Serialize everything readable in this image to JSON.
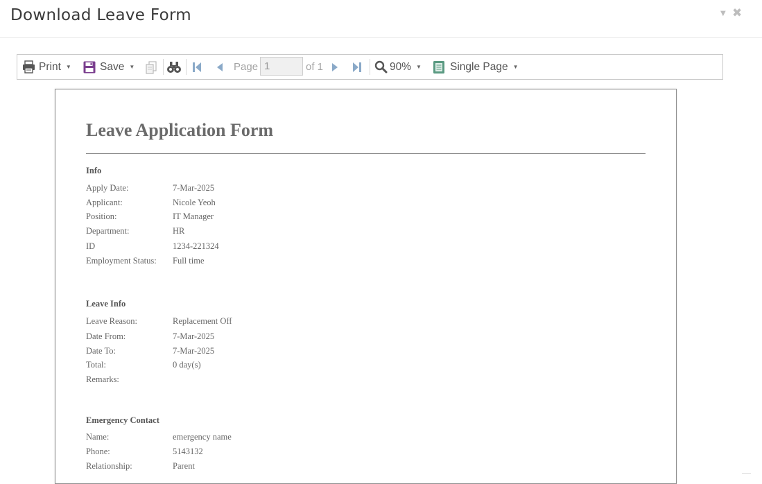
{
  "modal": {
    "title": "Download Leave Form"
  },
  "toolbar": {
    "print_label": "Print",
    "save_label": "Save",
    "page_label": "Page",
    "page_value": "1",
    "of_label": "of 1",
    "zoom_label": "90%",
    "view_label": "Single Page"
  },
  "document": {
    "title": "Leave Application Form",
    "info": {
      "heading": "Info",
      "rows": [
        {
          "label": "Apply Date:",
          "value": "7-Mar-2025"
        },
        {
          "label": "Applicant:",
          "value": "Nicole Yeoh"
        },
        {
          "label": "Position:",
          "value": "IT Manager"
        },
        {
          "label": "Department:",
          "value": "HR"
        },
        {
          "label": "ID",
          "value": "1234-221324"
        },
        {
          "label": "Employment Status:",
          "value": "Full time"
        }
      ]
    },
    "leave": {
      "heading": "Leave Info",
      "rows": [
        {
          "label": "Leave Reason:",
          "value": "Replacement Off"
        },
        {
          "label": "Date From:",
          "value": "7-Mar-2025"
        },
        {
          "label": "Date To:",
          "value": "7-Mar-2025"
        },
        {
          "label": "Total:",
          "value": "0 day(s)"
        },
        {
          "label": "Remarks:",
          "value": ""
        }
      ]
    },
    "emergency": {
      "heading": "Emergency Contact",
      "rows": [
        {
          "label": "Name:",
          "value": "emergency name"
        },
        {
          "label": "Phone:",
          "value": "5143132"
        },
        {
          "label": "Relationship:",
          "value": "Parent"
        }
      ]
    }
  },
  "icons": {
    "print": "printer-icon",
    "save": "floppy-icon",
    "copy": "copy-icon",
    "find": "binoculars-icon",
    "first": "first-page-icon",
    "prev": "prev-page-icon",
    "next": "next-page-icon",
    "last": "last-page-icon",
    "zoom": "magnifier-icon",
    "view": "single-page-icon",
    "close": "close-icon",
    "collapse": "collapse-icon"
  },
  "colors": {
    "save_icon": "#7b3f8f",
    "nav_icons": "#8aa9c8",
    "view_icon": "#5a9a82"
  }
}
